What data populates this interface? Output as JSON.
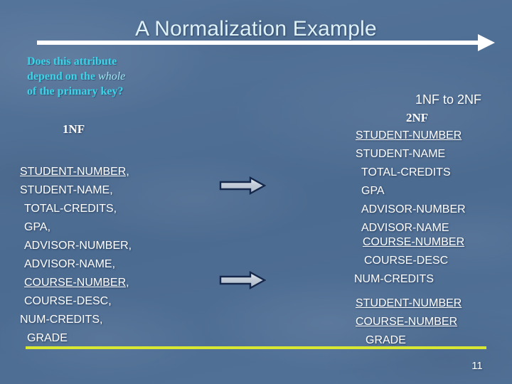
{
  "slide": {
    "title": "A Normalization Example",
    "page_number": "11",
    "background_color": "#4f6f96",
    "title_color": "#ddf1f7",
    "accent_rule_color": "#d8e832",
    "question_color": "#3ad5e8"
  },
  "question": {
    "line1": "Does this attribute",
    "line2_before": "depend on the ",
    "line2_emphasis": "whole",
    "line3": "of the primary key?"
  },
  "transition": {
    "heading": "1NF to 2NF"
  },
  "left_column": {
    "label": "1NF",
    "attributes": [
      {
        "text": "STUDENT-NUMBER,",
        "key": true
      },
      {
        "text": "STUDENT-NAME,",
        "key": false
      },
      {
        "text": "TOTAL-CREDITS,",
        "key": false
      },
      {
        "text": "GPA,",
        "key": false
      },
      {
        "text": "ADVISOR-NUMBER,",
        "key": false
      },
      {
        "text": "ADVISOR-NAME,",
        "key": false
      },
      {
        "text": "COURSE-NUMBER,",
        "key": true
      },
      {
        "text": "COURSE-DESC,",
        "key": false
      },
      {
        "text": "NUM-CREDITS,",
        "key": false
      },
      {
        "text": "GRADE",
        "key": false
      }
    ]
  },
  "right_column": {
    "label": "2NF",
    "tables": [
      {
        "name": "student-table",
        "attributes": [
          {
            "text": "STUDENT-NUMBER",
            "key": true
          },
          {
            "text": "STUDENT-NAME",
            "key": false
          },
          {
            "text": "TOTAL-CREDITS",
            "key": false
          },
          {
            "text": "GPA",
            "key": false
          },
          {
            "text": "ADVISOR-NUMBER",
            "key": false
          },
          {
            "text": "ADVISOR-NAME",
            "key": false
          }
        ]
      },
      {
        "name": "course-table",
        "attributes": [
          {
            "text": "COURSE-NUMBER",
            "key": true
          },
          {
            "text": "COURSE-DESC",
            "key": false
          },
          {
            "text": "NUM-CREDITS",
            "key": false
          }
        ]
      },
      {
        "name": "grade-table",
        "attributes": [
          {
            "text": "STUDENT-NUMBER",
            "key": true
          },
          {
            "text": "COURSE-NUMBER",
            "key": true
          },
          {
            "text": "GRADE",
            "key": false
          }
        ]
      }
    ]
  },
  "arrows": [
    {
      "name": "decomposition-arrow-1",
      "direction": "right"
    },
    {
      "name": "decomposition-arrow-2",
      "direction": "right"
    }
  ],
  "icons": {
    "title_arrow": "right-arrow-icon",
    "block_arrow": "block-right-arrow-icon"
  }
}
